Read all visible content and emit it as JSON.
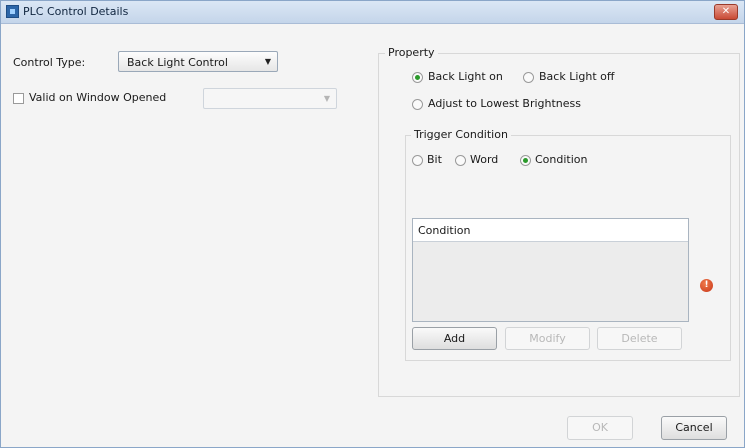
{
  "window": {
    "title": "PLC Control Details",
    "close_glyph": "✕"
  },
  "control_type": {
    "label": "Control Type:",
    "value": "Back Light Control"
  },
  "valid_on_window_opened": {
    "label": "Valid on Window Opened",
    "checked": false,
    "value": ""
  },
  "property": {
    "title": "Property",
    "back_light_on": {
      "label": "Back Light on",
      "selected": true
    },
    "back_light_off": {
      "label": "Back Light off",
      "selected": false
    },
    "adjust_lowest": {
      "label": "Adjust to Lowest Brightness",
      "selected": false
    }
  },
  "trigger_condition": {
    "title": "Trigger Condition",
    "bit": {
      "label": "Bit",
      "selected": false
    },
    "word": {
      "label": "Word",
      "selected": false
    },
    "condition": {
      "label": "Condition",
      "selected": true
    },
    "table_header": "Condition",
    "rows": []
  },
  "buttons": {
    "add": "Add",
    "modify": "Modify",
    "delete": "Delete",
    "ok": "OK",
    "cancel": "Cancel"
  },
  "icons": {
    "app": "plc-app-icon",
    "close": "close-icon",
    "warning": "error-icon"
  },
  "colors": {
    "radio_selected": "#2b9a2b",
    "warning": "#d4441f"
  }
}
